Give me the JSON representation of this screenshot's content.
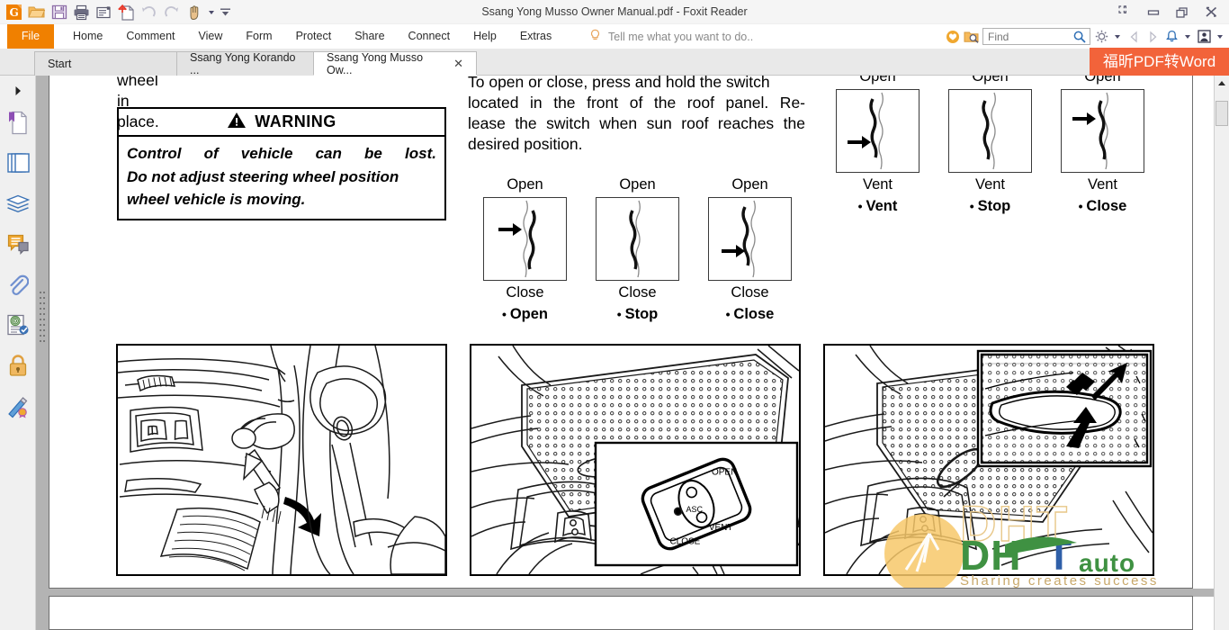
{
  "window": {
    "title": "Ssang Yong Musso Owner Manual.pdf - Foxit Reader",
    "controls": [
      {
        "name": "fullscreen-toggle",
        "label": "Full Screen"
      },
      {
        "name": "minimize",
        "label": "Minimize"
      },
      {
        "name": "restore",
        "label": "Restore"
      },
      {
        "name": "close",
        "label": "Close"
      }
    ]
  },
  "quick_access": [
    {
      "name": "foxit-logo-icon",
      "label": "Foxit"
    },
    {
      "name": "open-icon",
      "label": "Open"
    },
    {
      "name": "save-icon",
      "label": "Save"
    },
    {
      "name": "print-icon",
      "label": "Print"
    },
    {
      "name": "email-icon",
      "label": "Email"
    },
    {
      "name": "new-blank-icon",
      "label": "Create PDF"
    },
    {
      "name": "undo-icon",
      "label": "Undo"
    },
    {
      "name": "redo-icon",
      "label": "Redo"
    },
    {
      "name": "hand-tool-icon",
      "label": "Hand Tool"
    }
  ],
  "menu": {
    "file_label": "File",
    "items": [
      {
        "label": "Home"
      },
      {
        "label": "Comment"
      },
      {
        "label": "View"
      },
      {
        "label": "Form"
      },
      {
        "label": "Protect"
      },
      {
        "label": "Share"
      },
      {
        "label": "Connect"
      },
      {
        "label": "Help"
      },
      {
        "label": "Extras"
      }
    ],
    "tell_me": "Tell me what you want to do..",
    "right_icons": [
      {
        "name": "heart-icon",
        "label": "Favorites"
      },
      {
        "name": "search-folder-icon",
        "label": "Search in folder"
      }
    ],
    "settings_icon": "gear-icon",
    "nav_back_icon": "chevron-left-icon",
    "nav_forward_icon": "chevron-right-icon",
    "notification_icon": "bell-icon",
    "account_icon": "user-account-icon"
  },
  "search": {
    "placeholder": "Find",
    "value": "",
    "icon": "search-icon"
  },
  "promo": {
    "badge_label": "福昕PDF转Word"
  },
  "tabs": [
    {
      "label": "Start",
      "active": false,
      "closable": false
    },
    {
      "label": "Ssang Yong Korando ...",
      "active": false,
      "closable": false
    },
    {
      "label": "Ssang Yong Musso Ow...",
      "active": true,
      "closable": true,
      "close_label": "✕"
    }
  ],
  "left_nav": {
    "expand_icon": "expand-panel-arrow-icon",
    "items": [
      {
        "name": "bookmarks-icon",
        "label": "Bookmarks"
      },
      {
        "name": "page-thumbnails-icon",
        "label": "Page Thumbnails"
      },
      {
        "name": "layers-icon",
        "label": "Layers"
      },
      {
        "name": "comments-icon",
        "label": "Comments"
      },
      {
        "name": "attachments-icon",
        "label": "Attachments"
      },
      {
        "name": "stamps-icon",
        "label": "Stamps"
      },
      {
        "name": "security-lock-icon",
        "label": "Security"
      },
      {
        "name": "digital-signature-icon",
        "label": "Digital Signatures"
      }
    ]
  },
  "scrollbar": {
    "up_arrow_icon": "arrow-up-icon",
    "thumb_name": "vertical-scroll-thumb"
  },
  "document": {
    "left_column": {
      "continued_text": "wheel in place.",
      "warning": {
        "icon": "warning-triangle-icon",
        "heading": "WARNING",
        "lines": [
          "Control of vehicle can be lost.",
          "Do not adjust steering wheel position",
          "wheel vehicle is moving."
        ]
      },
      "figure_caption": "steering-column-adjust-illustration"
    },
    "middle_column": {
      "paragraph": "To open or close, press and hold the switch located in the front of the roof panel. Release the switch when sun roof reaches the desired position.",
      "paragraph_lines": [
        "To open or close, press and hold the switch",
        "located in the front of the roof panel. Re-",
        "lease the switch when sun roof reaches the",
        "desired position."
      ],
      "diagrams": [
        {
          "top_label": "Open",
          "bottom_label": "Close",
          "action": "Open",
          "arrow": "right",
          "arrow_pos": "upper",
          "panel_pos": "open"
        },
        {
          "top_label": "Open",
          "bottom_label": "Close",
          "action": "Stop",
          "arrow": "none",
          "arrow_pos": "",
          "panel_pos": "mid"
        },
        {
          "top_label": "Open",
          "bottom_label": "Close",
          "action": "Close",
          "arrow": "right",
          "arrow_pos": "lower",
          "panel_pos": "closed"
        }
      ],
      "figure_caption": "sun-roof-switch-illustration",
      "switch_labels": [
        "OPEN",
        "CLOSE",
        "VENT",
        "ASC"
      ]
    },
    "right_column": {
      "diagrams": [
        {
          "top_label": "Open",
          "bottom_label": "Vent",
          "action": "Vent",
          "arrow": "right",
          "arrow_pos": "lower",
          "panel_pos": "vent"
        },
        {
          "top_label": "Open",
          "bottom_label": "Vent",
          "action": "Stop",
          "arrow": "none",
          "arrow_pos": "",
          "panel_pos": "mid"
        },
        {
          "top_label": "Open",
          "bottom_label": "Vent",
          "action": "Close",
          "arrow": "right",
          "arrow_pos": "upper",
          "panel_pos": "closed"
        }
      ],
      "figure_caption": "sun-roof-vent-illustration"
    }
  },
  "watermark": {
    "primary": "DHT",
    "secondary": "auto",
    "tagline": "Sharing creates success",
    "colors": {
      "green": "#3f9142",
      "blue": "#2f5fa8",
      "gold": "#f5c86a"
    }
  },
  "colors": {
    "accent_orange": "#f08000",
    "promo_orange": "#f2633a",
    "chrome_gray": "#f0f0f0",
    "page_border": "#6f6f6f"
  }
}
